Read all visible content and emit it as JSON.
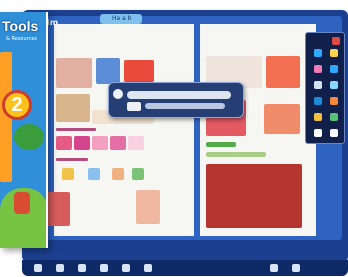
{
  "book": {
    "title": "Tools",
    "subtitle": "& Resources",
    "level": "2"
  },
  "screen": {
    "unit_header": "ay Tim",
    "tab_label": "Ha a b"
  },
  "colors": {
    "screen_frame": "#1c3f8f",
    "screen_bg": "#2e63c2",
    "book_blue": "#2f8fd8",
    "badge_yellow": "#ffc21a",
    "badge_red": "#d13c2f",
    "palette_bg": "#10204a"
  },
  "icons": [
    "pen-icon",
    "eraser-icon",
    "highlighter-icon",
    "camera-icon",
    "close-icon",
    "play-icon"
  ]
}
